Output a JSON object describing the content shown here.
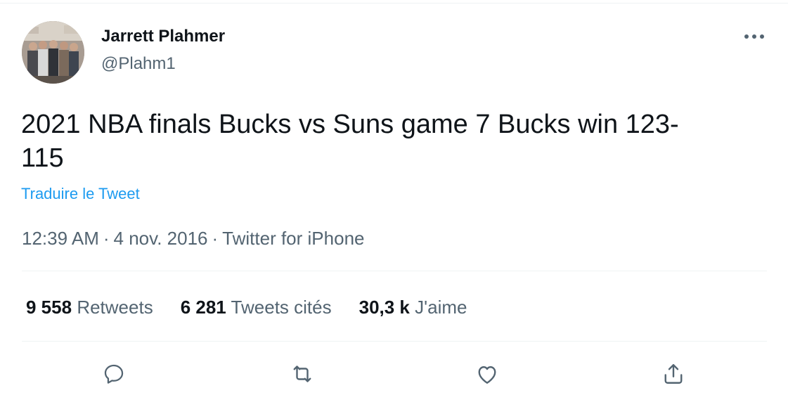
{
  "author": {
    "name": "Jarrett Plahmer",
    "handle": "@Plahm1"
  },
  "tweet": {
    "text_line1": "2021 NBA finals Bucks vs Suns game 7 Bucks win 123-",
    "text_line2": "115",
    "translate_label": "Traduire le Tweet",
    "time": "12:39 AM",
    "date": "4 nov. 2016",
    "separator": "·",
    "source": "Twitter for iPhone"
  },
  "stats": {
    "retweets_count": "9 558",
    "retweets_label": "Retweets",
    "quotes_count": "6 281",
    "quotes_label": "Tweets cités",
    "likes_count": "30,3 k",
    "likes_label": "J'aime"
  },
  "icons": {
    "more": "more-horizontal-icon",
    "reply": "reply-icon",
    "retweet": "retweet-icon",
    "like": "heart-icon",
    "share": "share-icon"
  },
  "colors": {
    "text": "#0f1419",
    "secondary": "#536471",
    "link": "#1d9bf0",
    "divider": "#eff3f4"
  }
}
